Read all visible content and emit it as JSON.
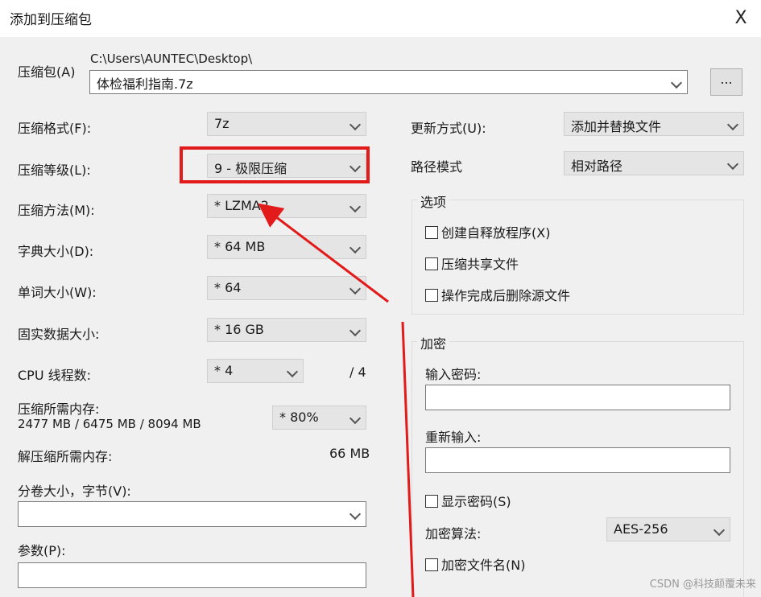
{
  "window": {
    "title": "添加到压缩包",
    "close_glyph": "X"
  },
  "archive": {
    "label": "压缩包(A)",
    "path": "C:\\Users\\AUNTEC\\Desktop\\",
    "filename": "体检福利指南.7z",
    "browse_label": "..."
  },
  "left": {
    "format": {
      "label": "压缩格式(F):",
      "value": "7z"
    },
    "level": {
      "label": "压缩等级(L):",
      "value": "9 - 极限压缩"
    },
    "method": {
      "label": "压缩方法(M):",
      "value": "* LZMA2"
    },
    "dict": {
      "label": "字典大小(D):",
      "value": "* 64 MB"
    },
    "word": {
      "label": "单词大小(W):",
      "value": "* 64"
    },
    "solid": {
      "label": "固实数据大小:",
      "value": "* 16 GB"
    },
    "cpu": {
      "label": "CPU 线程数:",
      "value": "* 4",
      "total": "/ 4"
    },
    "mem": {
      "label": "压缩所需内存:",
      "detail": "2477 MB / 6475 MB / 8094 MB",
      "value": "* 80%"
    },
    "unmem": {
      "label": "解压缩所需内存:",
      "value": "66 MB"
    },
    "volume": {
      "label": "分卷大小，字节(V):",
      "value": ""
    },
    "params": {
      "label": "参数(P):",
      "value": ""
    }
  },
  "right": {
    "update": {
      "label": "更新方式(U):",
      "value": "添加并替换文件"
    },
    "pathmode": {
      "label": "路径模式",
      "value": "相对路径"
    },
    "options": {
      "title": "选项",
      "items": [
        "创建自释放程序(X)",
        "压缩共享文件",
        "操作完成后删除源文件"
      ]
    },
    "encrypt": {
      "title": "加密",
      "pw_label": "输入密码:",
      "pw2_label": "重新输入:",
      "show_pw": "显示密码(S)",
      "algo_label": "加密算法:",
      "algo_value": "AES-256",
      "enc_names": "加密文件名(N)"
    }
  },
  "watermark": "CSDN @科技颠覆未来",
  "annotation": {
    "highlight_color": "#e31a1a"
  }
}
